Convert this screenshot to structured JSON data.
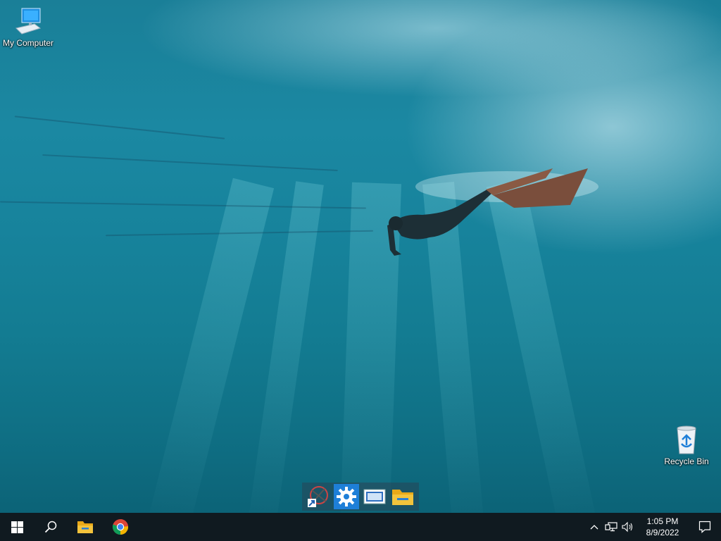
{
  "desktop": {
    "icons": [
      {
        "label": "My Computer",
        "icon": "computer-icon"
      },
      {
        "label": "Recycle Bin",
        "icon": "recycle-bin-icon"
      }
    ]
  },
  "dock": {
    "items": [
      {
        "icon": "app-shortcut-icon"
      },
      {
        "icon": "settings-gear-icon"
      },
      {
        "icon": "window-app-icon"
      },
      {
        "icon": "file-explorer-folder-icon"
      }
    ]
  },
  "taskbar": {
    "start_icon": "windows-logo-icon",
    "search_icon": "search-icon",
    "pinned": [
      {
        "icon": "file-explorer-icon"
      },
      {
        "icon": "chrome-icon"
      }
    ],
    "tray": {
      "icons": [
        "chevron-up-icon",
        "network-icon",
        "volume-icon"
      ],
      "time": "1:05 PM",
      "date": "8/9/2022",
      "notification_icon": "notification-icon"
    }
  },
  "colors": {
    "taskbar": "#101a20",
    "water": "#1b88a2",
    "accent_blue": "#1e7fd8",
    "folder_yellow": "#f3c33c"
  }
}
